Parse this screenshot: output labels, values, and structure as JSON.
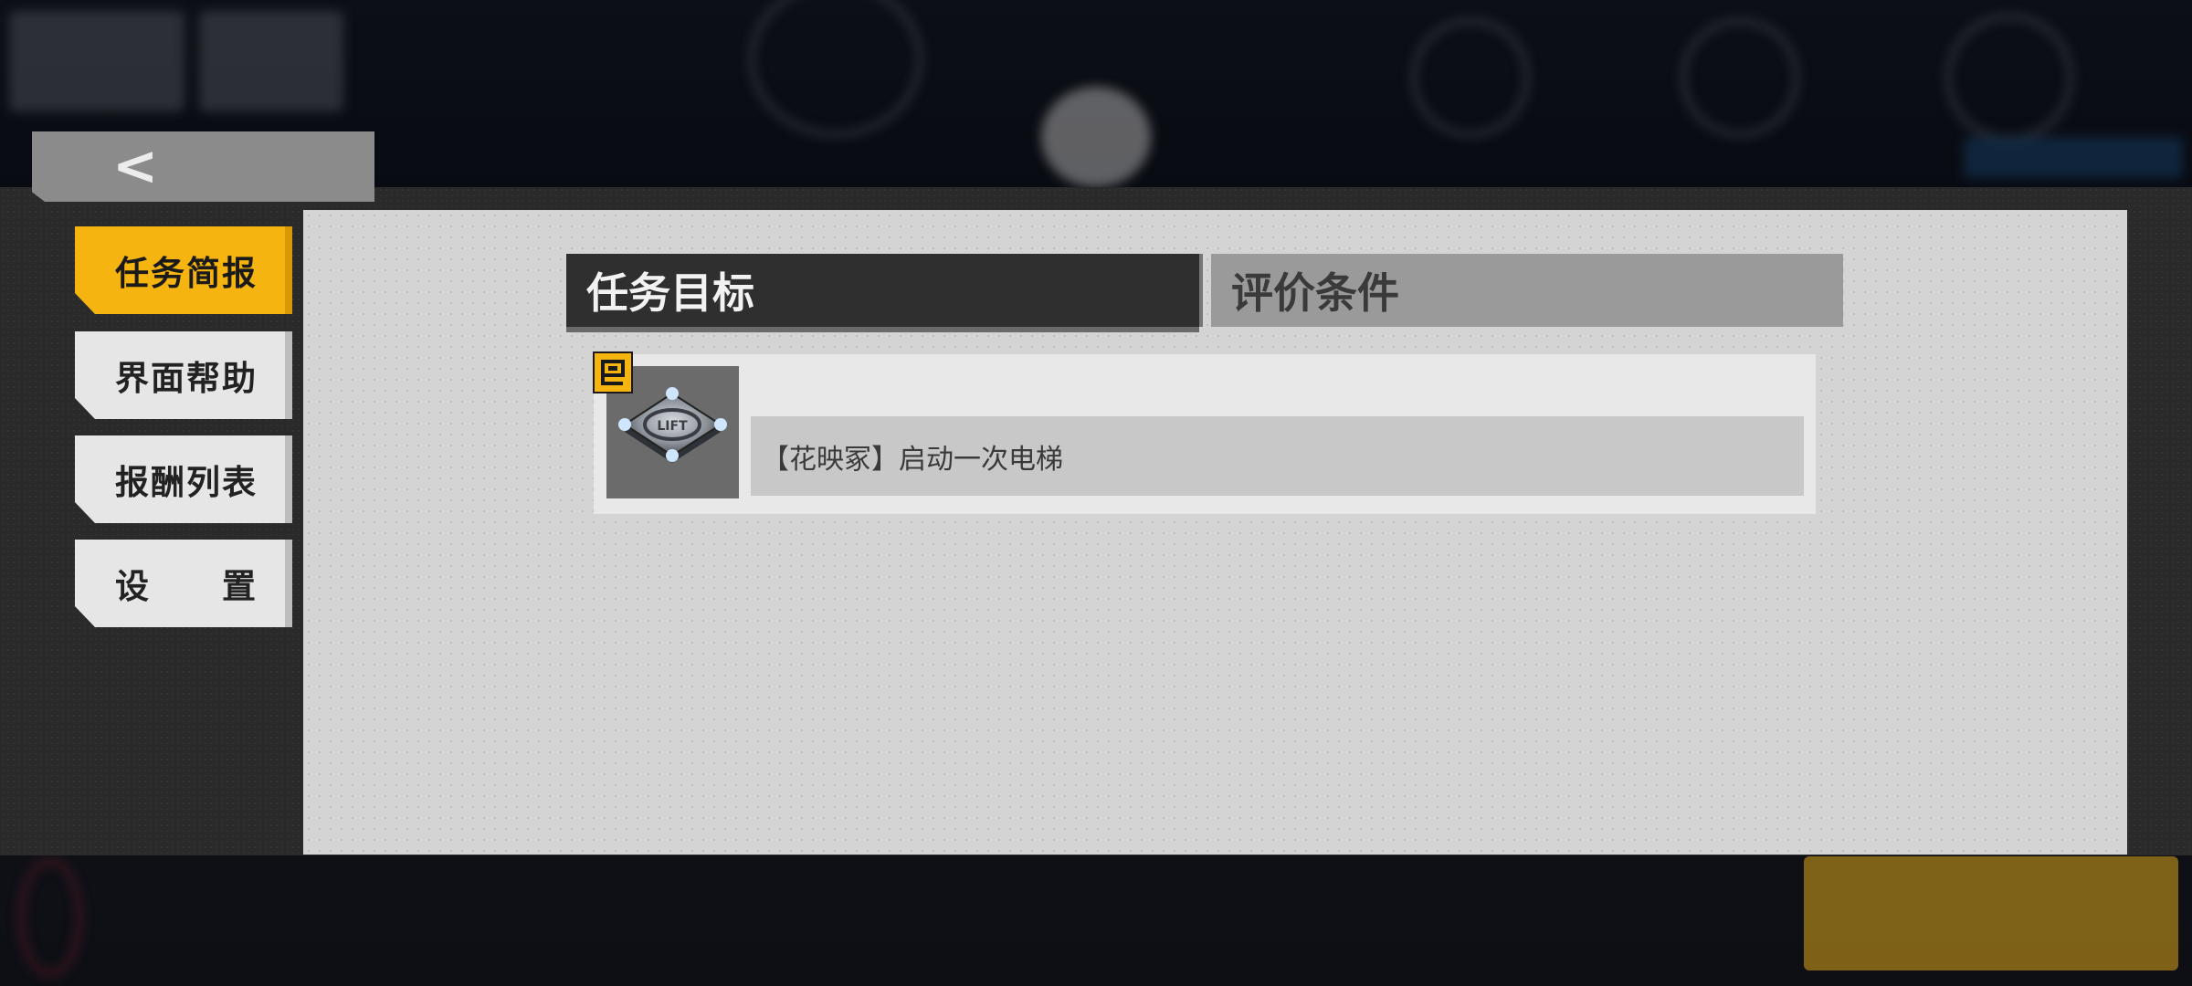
{
  "back_button": {
    "icon": "chevron-left-icon",
    "glyph": "<"
  },
  "side_menu": {
    "items": [
      {
        "label": "任务简报",
        "active": true
      },
      {
        "label": "界面帮助",
        "active": false
      },
      {
        "label": "报酬列表",
        "active": false
      },
      {
        "label": "设　　置",
        "active": false
      }
    ]
  },
  "tabs": {
    "objectives": "任务目标",
    "evaluation": "评价条件"
  },
  "objectives": [
    {
      "icon": "elevator-pad-icon",
      "badge_icon": "key-badge-icon",
      "text": "【花映冢】启动一次电梯"
    }
  ],
  "colors": {
    "accent": "#f5b40f",
    "panel": "#d4d4d4",
    "tab_active": "#2f2f2f",
    "tab_inactive": "#9a9a9a"
  }
}
